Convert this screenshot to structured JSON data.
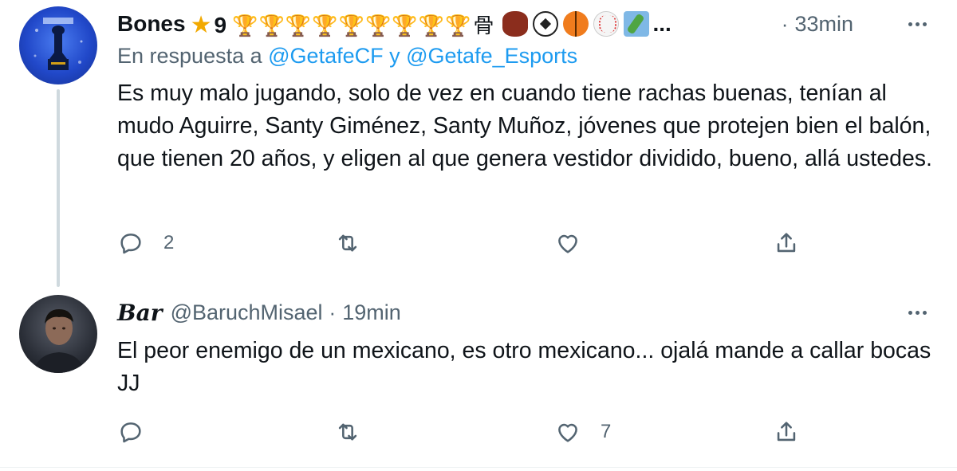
{
  "tweets": [
    {
      "display_name": "Bones",
      "name_suffix": "9",
      "trophy_count": 9,
      "kanji": "骨",
      "name_ellipsis": "...",
      "time": "33min",
      "reply_prefix": "En respuesta a",
      "reply_mention_1": "@GetafeCF",
      "reply_conjunction": "y",
      "reply_mention_2": "@Getafe_Esports",
      "body": "Es muy malo jugando, solo de vez en cuando tiene rachas buenas, tenían al mudo Aguirre, Santy Giménez, Santy Muñoz, jóvenes que protejen bien el balón, que tienen 20 años, y eligen al que genera vestidor dividido, bueno, allá ustedes.",
      "reply_count": "2",
      "retweet_count": "",
      "like_count": ""
    },
    {
      "display_name": "Bar",
      "username": "@BaruchMisael",
      "time": "19min",
      "body": "El peor enemigo de un mexicano, es otro mexicano... ojalá mande a callar bocas JJ",
      "reply_count": "",
      "retweet_count": "",
      "like_count": "7"
    }
  ],
  "icons": {
    "reply": "reply-icon",
    "retweet": "retweet-icon",
    "like": "heart-icon",
    "share": "share-icon",
    "more": "more-icon"
  },
  "colors": {
    "text_primary": "#0f1419",
    "text_secondary": "#536471",
    "mention": "#1d9bf0",
    "thread_line": "#cfd9de",
    "trophy": "#f2a900"
  }
}
